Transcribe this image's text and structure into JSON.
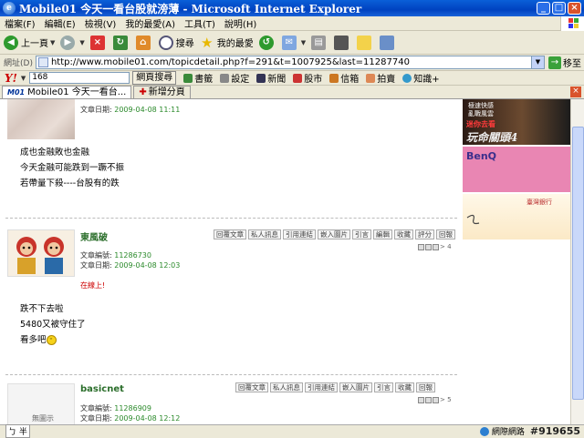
{
  "window": {
    "title": "Mobile01 今天一看台股就滂薄 - Microsoft Internet Explorer",
    "minimize": "_",
    "maximize": "□",
    "close": "×"
  },
  "menu": [
    "檔案(F)",
    "編輯(E)",
    "檢視(V)",
    "我的最愛(A)",
    "工具(T)",
    "說明(H)"
  ],
  "toolbar": {
    "back": "上一頁",
    "search": "搜尋",
    "favorites": "我的最愛"
  },
  "address": {
    "label": "網址(D)",
    "url": "http://www.mobile01.com/topicdetail.php?f=291&t=1007925&last=11287740",
    "go": "移至"
  },
  "yahoo": {
    "logo": "Y!",
    "query": "168",
    "search_btn": "網頁搜尋",
    "items": [
      "書籤",
      "設定",
      "新聞",
      "股市",
      "信箱",
      "拍賣",
      "知識+"
    ]
  },
  "tabs": {
    "active": "Mobile01 今天一看台...",
    "new_tab": "新增分頁",
    "mobile_mark": "M01"
  },
  "posts": [
    {
      "date_label": "文章日期",
      "date": "2009-04-08 11:11",
      "lines": [
        "成也金融敗也金融",
        "今天金融可能跌到一蹶不振",
        "若帶量下殺----台股有的跌"
      ]
    },
    {
      "username": "東風破",
      "id_label": "文章編號",
      "id": "11286730",
      "date_label": "文章日期",
      "date": "2009-04-08 12:03",
      "online": "在線上!",
      "lines": [
        "跌不下去啦",
        "5480又被守住了",
        "看多吧"
      ],
      "pager": "> 4"
    },
    {
      "username": "basicnet",
      "id_label": "文章編號",
      "id": "11286909",
      "date_label": "文章日期",
      "date": "2009-04-08 12:12",
      "pager": "> 5",
      "avatar_text": "無圖示"
    }
  ],
  "actions": [
    "回覆文章",
    "私人訊息",
    "引用連結",
    "嵌入圖片",
    "引言",
    "編輯",
    "收藏",
    "評分",
    "回報"
  ],
  "ads": {
    "ad1_line1": "極速快感",
    "ad1_line2": "亂戰風雲",
    "ad1_line3": "迷你去看",
    "ad1_brand": "玩命關頭4",
    "ad2": "BenQ",
    "ad3": "臺灣銀行"
  },
  "status": {
    "zone": "網際網路",
    "watermark": "#919655",
    "ime": "ㄅ 半"
  },
  "colors": {
    "title_blue": "#0042c0",
    "username_green": "#2b6e2b",
    "online_red": "#cc0000",
    "benq_pink": "#e986b3"
  }
}
